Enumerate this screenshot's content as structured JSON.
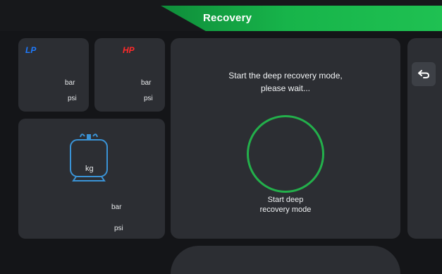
{
  "header": {
    "title": "Recovery"
  },
  "gauges": {
    "lp": {
      "label": "LP",
      "unit_bar": "bar",
      "unit_psi": "psi"
    },
    "hp": {
      "label": "HP",
      "unit_bar": "bar",
      "unit_psi": "psi"
    }
  },
  "tank": {
    "unit_kg": "kg",
    "unit_bar": "bar",
    "unit_psi": "psi"
  },
  "main": {
    "message_line1": "Start the deep recovery mode,",
    "message_line2": "please wait...",
    "ring_label_line1": "Start deep",
    "ring_label_line2": "recovery mode"
  },
  "icons": {
    "back": "return-arrow-icon",
    "tank": "refrigerant-tank-icon"
  },
  "colors": {
    "accent_green": "#1fb84d",
    "lp_blue": "#1e7bff",
    "hp_red": "#ff2a2a",
    "tank_blue": "#3a93d6"
  }
}
